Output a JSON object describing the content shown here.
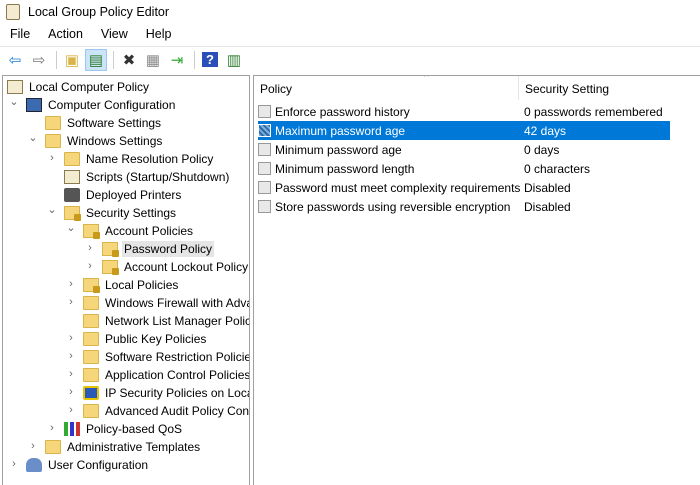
{
  "window": {
    "title": "Local Group Policy Editor"
  },
  "menu": [
    "File",
    "Action",
    "View",
    "Help"
  ],
  "toolbar": [
    {
      "icon": "back-arrow-icon",
      "glyph": "⇦",
      "color": "#1e7fd6"
    },
    {
      "icon": "forward-arrow-icon",
      "glyph": "⇨",
      "color": "#777"
    },
    {
      "sep": true
    },
    {
      "icon": "up-folder-icon",
      "glyph": "▣",
      "color": "#d9b44a"
    },
    {
      "icon": "show-hide-tree-icon",
      "glyph": "▤",
      "color": "#2a7a2a",
      "active": true
    },
    {
      "sep": true
    },
    {
      "icon": "delete-icon",
      "glyph": "✖",
      "color": "#333"
    },
    {
      "icon": "properties-icon",
      "glyph": "▦",
      "color": "#888"
    },
    {
      "icon": "export-list-icon",
      "glyph": "⇥",
      "color": "#3a3"
    },
    {
      "sep": true
    },
    {
      "icon": "help-icon",
      "glyph": "?",
      "color": "#fff",
      "bg": "#2a4fb8"
    },
    {
      "icon": "show-action-pane-icon",
      "glyph": "▥",
      "color": "#2a7a2a"
    }
  ],
  "tree": [
    {
      "label": "Local Computer Policy",
      "level": 0,
      "arrow": "",
      "icon": "scroll"
    },
    {
      "label": "Computer Configuration",
      "level": 1,
      "arrow": "open",
      "icon": "comp"
    },
    {
      "label": "Software Settings",
      "level": 2,
      "arrow": "",
      "icon": "folder"
    },
    {
      "label": "Windows Settings",
      "level": 2,
      "arrow": "open",
      "icon": "folder"
    },
    {
      "label": "Name Resolution Policy",
      "level": 3,
      "arrow": "closed",
      "icon": "folder"
    },
    {
      "label": "Scripts (Startup/Shutdown)",
      "level": 3,
      "arrow": "",
      "icon": "scroll"
    },
    {
      "label": "Deployed Printers",
      "level": 3,
      "arrow": "",
      "icon": "printer"
    },
    {
      "label": "Security Settings",
      "level": 3,
      "arrow": "open",
      "icon": "lockf"
    },
    {
      "label": "Account Policies",
      "level": 4,
      "arrow": "open",
      "icon": "lockf"
    },
    {
      "label": "Password Policy",
      "level": 5,
      "arrow": "closed",
      "icon": "lockf",
      "selected": true
    },
    {
      "label": "Account Lockout Policy",
      "level": 5,
      "arrow": "closed",
      "icon": "lockf"
    },
    {
      "label": "Local Policies",
      "level": 4,
      "arrow": "closed",
      "icon": "lockf"
    },
    {
      "label": "Windows Firewall with Advanced Security",
      "level": 4,
      "arrow": "closed",
      "icon": "folder"
    },
    {
      "label": "Network List Manager Policies",
      "level": 4,
      "arrow": "",
      "icon": "folder"
    },
    {
      "label": "Public Key Policies",
      "level": 4,
      "arrow": "closed",
      "icon": "folder"
    },
    {
      "label": "Software Restriction Policies",
      "level": 4,
      "arrow": "closed",
      "icon": "folder"
    },
    {
      "label": "Application Control Policies",
      "level": 4,
      "arrow": "closed",
      "icon": "folder"
    },
    {
      "label": "IP Security Policies on Local Computer",
      "level": 4,
      "arrow": "closed",
      "icon": "ipsec"
    },
    {
      "label": "Advanced Audit Policy Configuration",
      "level": 4,
      "arrow": "closed",
      "icon": "folder"
    },
    {
      "label": "Policy-based QoS",
      "level": 3,
      "arrow": "closed",
      "icon": "qos"
    },
    {
      "label": "Administrative Templates",
      "level": 2,
      "arrow": "closed",
      "icon": "folder"
    },
    {
      "label": "User Configuration",
      "level": 1,
      "arrow": "closed",
      "icon": "user"
    }
  ],
  "list": {
    "columns": [
      "Policy",
      "Security Setting"
    ],
    "rows": [
      {
        "policy": "Enforce password history",
        "setting": "0 passwords remembered"
      },
      {
        "policy": "Maximum password age",
        "setting": "42 days",
        "selected": true
      },
      {
        "policy": "Minimum password age",
        "setting": "0 days"
      },
      {
        "policy": "Minimum password length",
        "setting": "0 characters"
      },
      {
        "policy": "Password must meet complexity requirements",
        "setting": "Disabled"
      },
      {
        "policy": "Store passwords using reversible encryption",
        "setting": "Disabled"
      }
    ]
  }
}
